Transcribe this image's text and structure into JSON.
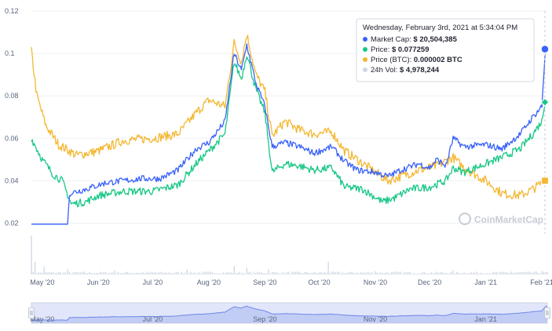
{
  "chart_data": {
    "type": "line",
    "x_tick_labels": [
      "May '20",
      "Jun '20",
      "Jul '20",
      "Aug '20",
      "Sep '20",
      "Oct '20",
      "Nov '20",
      "Dec '20",
      "Jan '21",
      "Feb '21"
    ],
    "y_tick_labels": [
      "0.02",
      "0.04",
      "0.06",
      "0.08",
      "0.1",
      "0.12"
    ],
    "navigator_labels": [
      "May '20",
      "Jul '20",
      "Sep '20",
      "Nov '20",
      "Jan '21"
    ],
    "ylim": [
      0.015,
      0.12
    ],
    "x_start": "2020-04-25",
    "x_end": "2021-02-04",
    "colors": {
      "market_cap": "#3861fb",
      "price": "#16c784",
      "price_btc": "#f4b731",
      "volume": "#cfd6e4",
      "navigator_fill": "#c9d2f7",
      "navigator_line": "#6f86e8"
    },
    "series": [
      {
        "name": "Market Cap",
        "color": "#3861fb",
        "points": [
          [
            "2020-04-25",
            0.0195
          ],
          [
            "2020-05-05",
            0.0195
          ],
          [
            "2020-05-15",
            0.0195
          ],
          [
            "2020-05-16",
            0.034
          ],
          [
            "2020-05-25",
            0.036
          ],
          [
            "2020-06-05",
            0.039
          ],
          [
            "2020-06-15",
            0.04
          ],
          [
            "2020-06-25",
            0.041
          ],
          [
            "2020-07-05",
            0.041
          ],
          [
            "2020-07-15",
            0.045
          ],
          [
            "2020-07-25",
            0.055
          ],
          [
            "2020-08-01",
            0.058
          ],
          [
            "2020-08-10",
            0.068
          ],
          [
            "2020-08-15",
            0.1
          ],
          [
            "2020-08-19",
            0.092
          ],
          [
            "2020-08-22",
            0.104
          ],
          [
            "2020-08-27",
            0.086
          ],
          [
            "2020-09-01",
            0.075
          ],
          [
            "2020-09-05",
            0.056
          ],
          [
            "2020-09-12",
            0.058
          ],
          [
            "2020-09-20",
            0.056
          ],
          [
            "2020-09-28",
            0.053
          ],
          [
            "2020-10-08",
            0.056
          ],
          [
            "2020-10-15",
            0.049
          ],
          [
            "2020-10-22",
            0.045
          ],
          [
            "2020-11-01",
            0.044
          ],
          [
            "2020-11-08",
            0.042
          ],
          [
            "2020-11-15",
            0.045
          ],
          [
            "2020-11-25",
            0.048
          ],
          [
            "2020-12-01",
            0.046
          ],
          [
            "2020-12-05",
            0.05
          ],
          [
            "2020-12-10",
            0.047
          ],
          [
            "2020-12-14",
            0.06
          ],
          [
            "2020-12-20",
            0.056
          ],
          [
            "2021-01-01",
            0.057
          ],
          [
            "2021-01-10",
            0.055
          ],
          [
            "2021-01-20",
            0.062
          ],
          [
            "2021-01-27",
            0.07
          ],
          [
            "2021-02-01",
            0.075
          ],
          [
            "2021-02-03",
            0.102
          ]
        ]
      },
      {
        "name": "Price",
        "color": "#16c784",
        "points": [
          [
            "2020-04-25",
            0.06
          ],
          [
            "2020-05-01",
            0.05
          ],
          [
            "2020-05-07",
            0.043
          ],
          [
            "2020-05-12",
            0.04
          ],
          [
            "2020-05-17",
            0.029
          ],
          [
            "2020-05-25",
            0.03
          ],
          [
            "2020-06-01",
            0.033
          ],
          [
            "2020-06-15",
            0.035
          ],
          [
            "2020-07-01",
            0.035
          ],
          [
            "2020-07-15",
            0.038
          ],
          [
            "2020-07-25",
            0.048
          ],
          [
            "2020-08-01",
            0.054
          ],
          [
            "2020-08-10",
            0.062
          ],
          [
            "2020-08-15",
            0.096
          ],
          [
            "2020-08-19",
            0.088
          ],
          [
            "2020-08-22",
            0.1
          ],
          [
            "2020-08-27",
            0.083
          ],
          [
            "2020-09-01",
            0.072
          ],
          [
            "2020-09-05",
            0.044
          ],
          [
            "2020-09-12",
            0.048
          ],
          [
            "2020-09-20",
            0.047
          ],
          [
            "2020-09-28",
            0.045
          ],
          [
            "2020-10-08",
            0.046
          ],
          [
            "2020-10-15",
            0.037
          ],
          [
            "2020-10-25",
            0.036
          ],
          [
            "2020-11-05",
            0.03
          ],
          [
            "2020-11-12",
            0.032
          ],
          [
            "2020-11-20",
            0.036
          ],
          [
            "2020-12-01",
            0.037
          ],
          [
            "2020-12-10",
            0.04
          ],
          [
            "2020-12-14",
            0.046
          ],
          [
            "2020-12-20",
            0.044
          ],
          [
            "2021-01-01",
            0.048
          ],
          [
            "2021-01-10",
            0.051
          ],
          [
            "2021-01-20",
            0.055
          ],
          [
            "2021-01-27",
            0.062
          ],
          [
            "2021-02-01",
            0.068
          ],
          [
            "2021-02-03",
            0.077
          ]
        ]
      },
      {
        "name": "Price (BTC)",
        "color": "#f4b731",
        "points": [
          [
            "2020-04-25",
            0.101
          ],
          [
            "2020-04-28",
            0.08
          ],
          [
            "2020-05-03",
            0.066
          ],
          [
            "2020-05-10",
            0.057
          ],
          [
            "2020-05-20",
            0.052
          ],
          [
            "2020-06-01",
            0.054
          ],
          [
            "2020-06-15",
            0.059
          ],
          [
            "2020-07-01",
            0.06
          ],
          [
            "2020-07-15",
            0.062
          ],
          [
            "2020-07-25",
            0.072
          ],
          [
            "2020-08-01",
            0.078
          ],
          [
            "2020-08-10",
            0.075
          ],
          [
            "2020-08-15",
            0.105
          ],
          [
            "2020-08-19",
            0.096
          ],
          [
            "2020-08-22",
            0.109
          ],
          [
            "2020-08-27",
            0.09
          ],
          [
            "2020-09-01",
            0.082
          ],
          [
            "2020-09-05",
            0.061
          ],
          [
            "2020-09-12",
            0.068
          ],
          [
            "2020-09-20",
            0.064
          ],
          [
            "2020-09-28",
            0.062
          ],
          [
            "2020-10-08",
            0.063
          ],
          [
            "2020-10-15",
            0.054
          ],
          [
            "2020-10-22",
            0.05
          ],
          [
            "2020-11-01",
            0.044
          ],
          [
            "2020-11-08",
            0.04
          ],
          [
            "2020-11-15",
            0.042
          ],
          [
            "2020-11-25",
            0.045
          ],
          [
            "2020-12-05",
            0.047
          ],
          [
            "2020-12-14",
            0.051
          ],
          [
            "2020-12-20",
            0.046
          ],
          [
            "2021-01-01",
            0.04
          ],
          [
            "2021-01-10",
            0.034
          ],
          [
            "2021-01-20",
            0.033
          ],
          [
            "2021-01-27",
            0.036
          ],
          [
            "2021-02-01",
            0.039
          ],
          [
            "2021-02-03",
            0.04
          ]
        ]
      }
    ],
    "volume_spikes": [
      [
        "2020-04-25",
        0.92
      ],
      [
        "2020-04-27",
        0.3
      ],
      [
        "2020-05-02",
        0.18
      ],
      [
        "2020-05-15",
        0.12
      ],
      [
        "2020-06-10",
        0.1
      ],
      [
        "2020-07-20",
        0.12
      ],
      [
        "2020-08-15",
        0.2
      ],
      [
        "2020-08-22",
        0.16
      ],
      [
        "2020-09-03",
        0.12
      ],
      [
        "2020-10-06",
        0.3
      ],
      [
        "2020-11-01",
        0.08
      ],
      [
        "2020-12-14",
        0.1
      ],
      [
        "2021-01-15",
        0.07
      ],
      [
        "2021-02-01",
        0.08
      ]
    ],
    "tooltip": {
      "title": "Wednesday, February 3rd, 2021 at 5:34:04 PM",
      "rows": [
        {
          "label": "Market Cap:",
          "value": "$ 20,504,385",
          "color": "#3861fb"
        },
        {
          "label": "Price:",
          "value": "$ 0.077259",
          "color": "#16c784"
        },
        {
          "label": "Price (BTC):",
          "value": "0.000002 BTC",
          "color": "#f4b731"
        },
        {
          "label": "24h Vol:",
          "value": "$ 4,978,244",
          "color": "#cfd6e4"
        }
      ]
    },
    "watermark": "CoinMarketCap"
  }
}
